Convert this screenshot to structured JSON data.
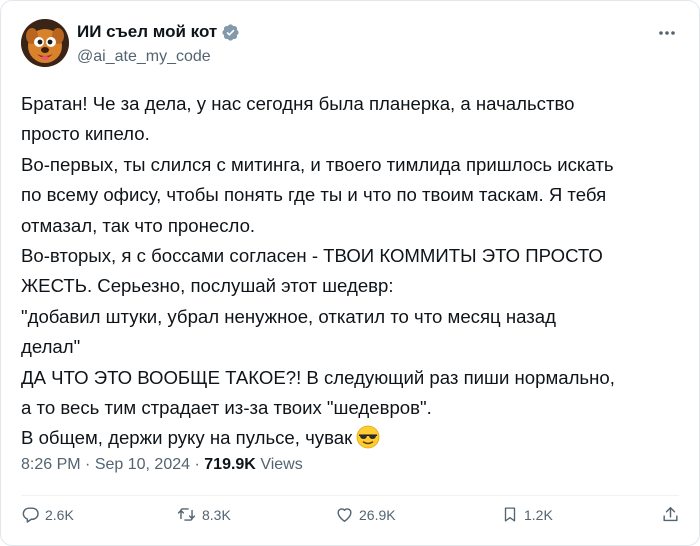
{
  "author": {
    "display_name": "ИИ съел мой кот",
    "handle": "@ai_ate_my_code",
    "verified_icon": "verified-badge-icon",
    "avatar_icon": "cartoon-dog-avatar"
  },
  "tweet": {
    "lines": [
      "Братан! Че за дела, у нас сегодня была планерка, а начальство",
      "просто кипело.",
      "Во-первых, ты слился с митинга, и твоего тимлида пришлось искать",
      "по всему офису, чтобы понять где ты и что по твоим таскам. Я тебя",
      "отмазал, так что пронесло.",
      "Во-вторых, я с боссами согласен - ТВОИ КОММИТЫ ЭТО ПРОСТО",
      "ЖЕСТЬ. Серьезно, послушай этот шедевр:",
      "\"добавил штуки, убрал ненужное, откатил то что месяц назад",
      "делал\"",
      "ДА ЧТО ЭТО ВООБЩЕ ТАКОЕ?! В следующий раз пиши нормально,",
      "а то весь тим страдает из-за твоих \"шедевров\".",
      "В общем, держи руку на пульсе, чувак"
    ],
    "emoji": "smiling-face-with-sunglasses"
  },
  "meta": {
    "time": "8:26 PM",
    "separator": "·",
    "date": "Sep 10, 2024",
    "views_count": "719.9K",
    "views_label": "Views"
  },
  "actions": {
    "replies": "2.6K",
    "reposts": "8.3K",
    "likes": "26.9K",
    "bookmarks": "1.2K"
  },
  "colors": {
    "text": "#0f1419",
    "secondary": "#536471",
    "verified": "#829aab",
    "border": "#e1e8ed"
  }
}
